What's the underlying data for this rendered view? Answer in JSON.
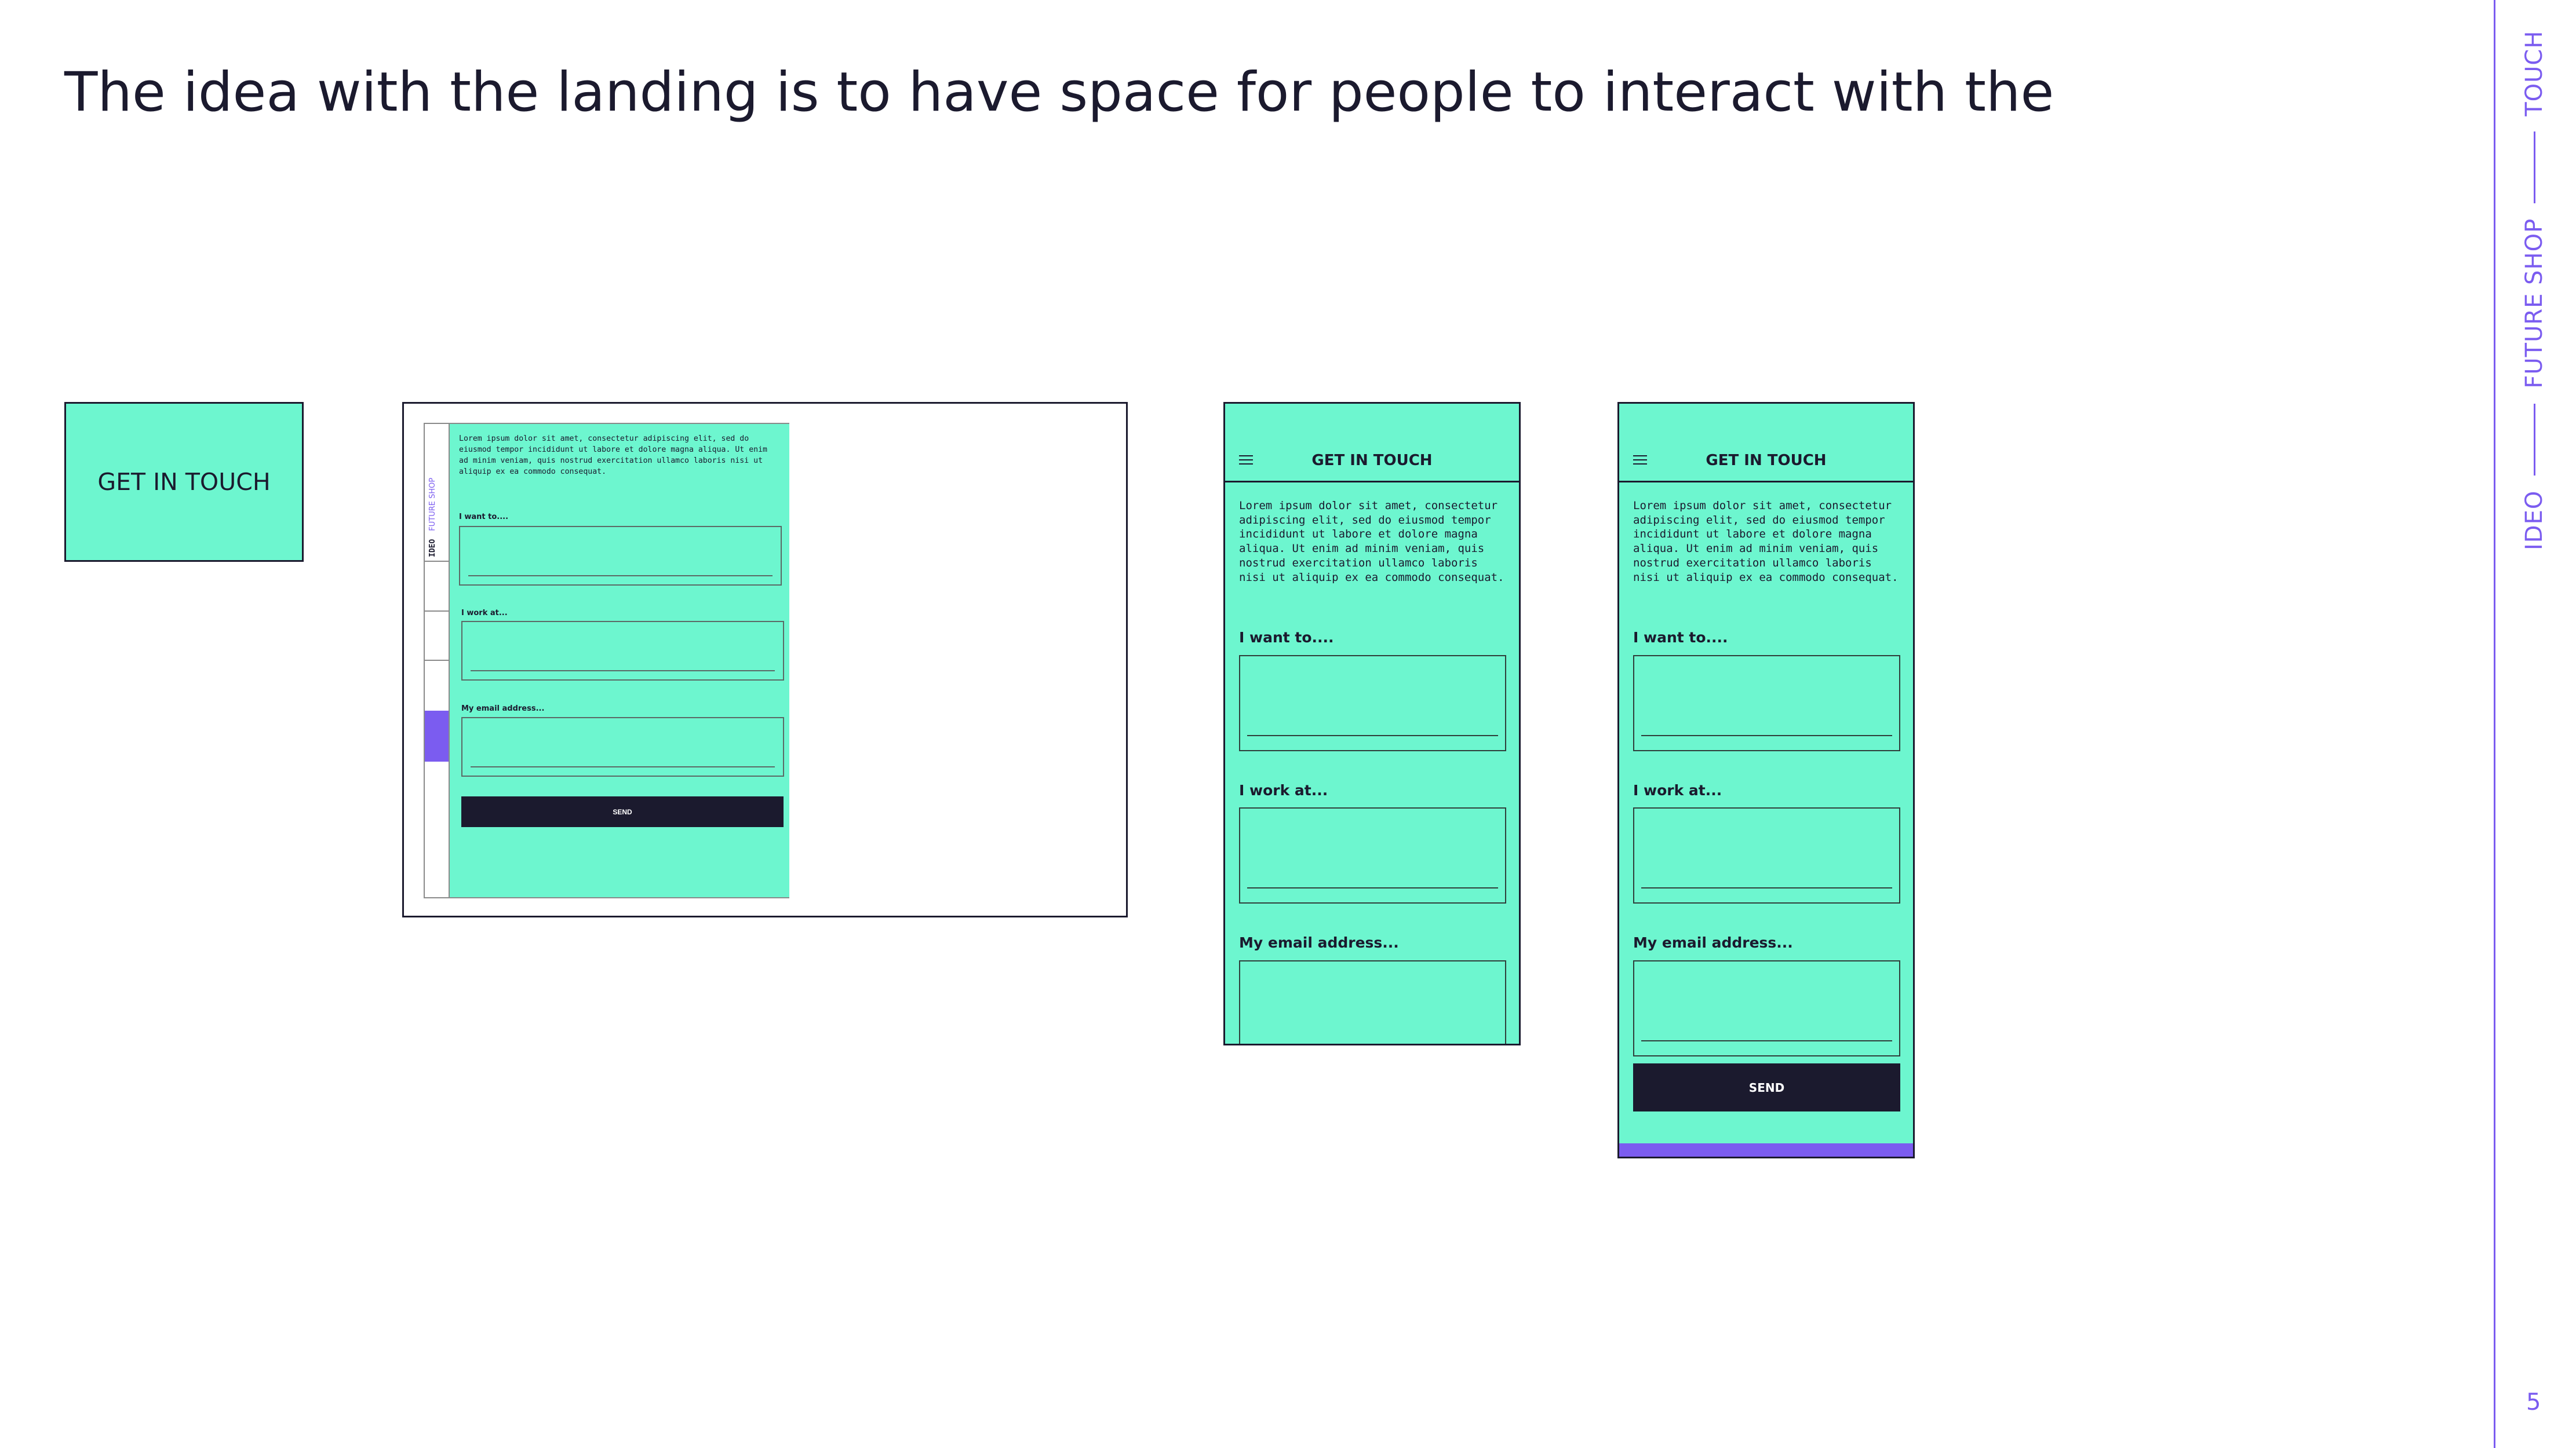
{
  "slide": {
    "title": "The idea with the landing is to have space for people to interact with the",
    "page_number": "5"
  },
  "rail": {
    "items": [
      "IDEO",
      "FUTURE SHOP",
      "TOUCH"
    ],
    "color": "#7b5cf0"
  },
  "card": {
    "label": "GET IN TOUCH"
  },
  "colors": {
    "mint": "#6df6cf",
    "ink": "#1b1a2e",
    "purple": "#7b5cf0"
  },
  "desktop": {
    "brand_a": "IDEO",
    "brand_b": "FUTURE SHOP",
    "lorem": "Lorem ipsum dolor sit amet, consectetur adipiscing elit, sed do eiusmod tempor incididunt ut labore et dolore magna aliqua. Ut enim ad minim veniam, quis nostrud exercitation ullamco laboris nisi ut aliquip ex ea commodo consequat.",
    "field_1": "I want to....",
    "field_2": "I work at...",
    "field_3": "My email address...",
    "send": "SEND"
  },
  "mobile": {
    "header": "GET IN TOUCH",
    "lorem": "Lorem ipsum dolor sit amet, consectetur adipiscing elit, sed do eiusmod tempor incididunt ut labore et dolore magna aliqua. Ut enim ad minim veniam, quis nostrud exercitation ullamco laboris nisi ut aliquip ex ea commodo consequat.",
    "field_1": "I want to....",
    "field_2": "I work at...",
    "field_3": "My email address...",
    "send": "SEND"
  }
}
